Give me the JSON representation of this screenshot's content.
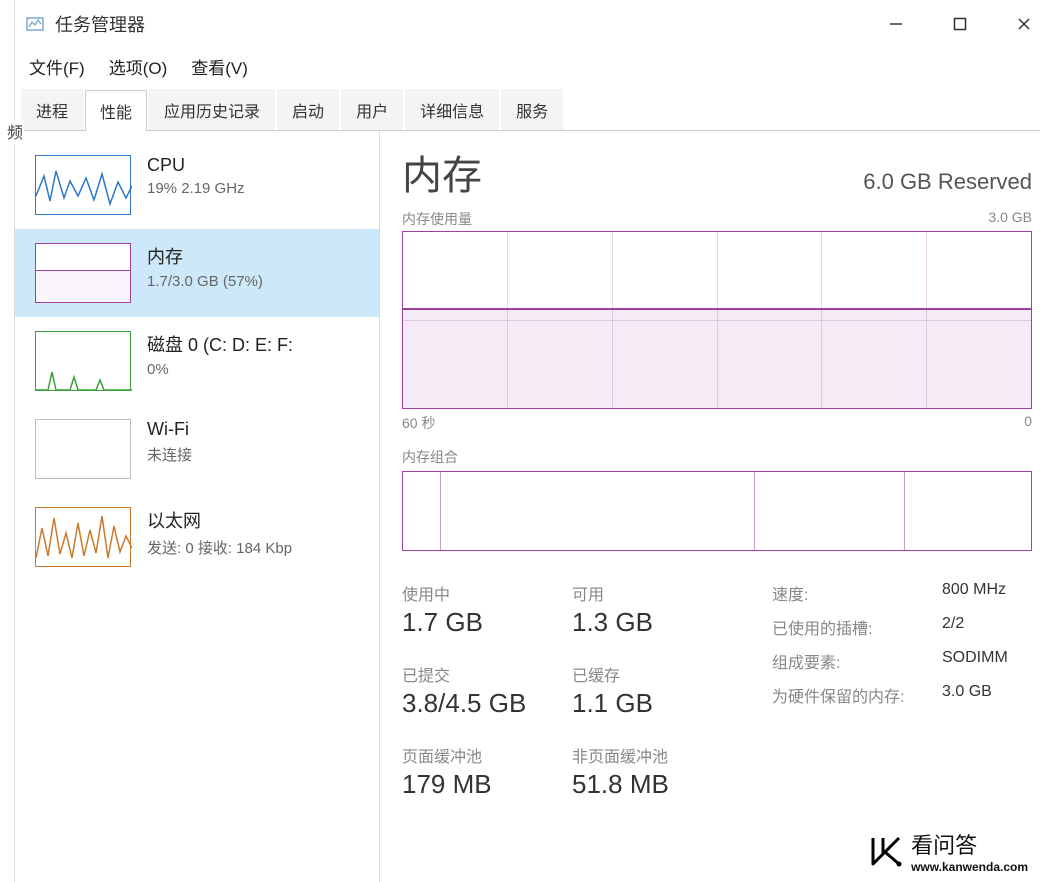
{
  "window": {
    "title": "任务管理器"
  },
  "menu": {
    "file": "文件(F)",
    "options": "选项(O)",
    "view": "查看(V)"
  },
  "tabs": {
    "processes": "进程",
    "performance": "性能",
    "app_history": "应用历史记录",
    "startup": "启动",
    "users": "用户",
    "details": "详细信息",
    "services": "服务"
  },
  "sidebar": {
    "cpu": {
      "name": "CPU",
      "detail": "19% 2.19 GHz"
    },
    "memory": {
      "name": "内存",
      "detail": "1.7/3.0 GB (57%)"
    },
    "disk": {
      "name": "磁盘 0 (C: D: E: F:",
      "detail": "0%"
    },
    "wifi": {
      "name": "Wi-Fi",
      "detail": "未连接"
    },
    "ethernet": {
      "name": "以太网",
      "detail": "发送: 0 接收: 184 Kbp"
    }
  },
  "main": {
    "title": "内存",
    "header_right": "6.0 GB Reserved",
    "chart_title": "内存使用量",
    "chart_max": "3.0 GB",
    "axis_left": "60 秒",
    "axis_right": "0",
    "composition_title": "内存组合"
  },
  "stats": {
    "in_use": {
      "label": "使用中",
      "value": "1.7 GB"
    },
    "available": {
      "label": "可用",
      "value": "1.3 GB"
    },
    "committed": {
      "label": "已提交",
      "value": "3.8/4.5 GB"
    },
    "cached": {
      "label": "已缓存",
      "value": "1.1 GB"
    },
    "paged": {
      "label": "页面缓冲池",
      "value": "179 MB"
    },
    "nonpaged": {
      "label": "非页面缓冲池",
      "value": "51.8 MB"
    }
  },
  "specs": {
    "speed": {
      "label": "速度:",
      "value": "800 MHz"
    },
    "slots": {
      "label": "已使用的插槽:",
      "value": "2/2"
    },
    "form": {
      "label": "组成要素:",
      "value": "SODIMM"
    },
    "reserved": {
      "label": "为硬件保留的内存:",
      "value": "3.0 GB"
    }
  },
  "watermark": {
    "text": "看问答",
    "url": "www.kanwenda.com"
  },
  "edge_tab": "频",
  "chart_data": {
    "type": "area",
    "title": "内存使用量",
    "ylabel": "GB",
    "ylim": [
      0,
      3.0
    ],
    "x_window_seconds": 60,
    "values": [
      1.7,
      1.7,
      1.7,
      1.7,
      1.7,
      1.7,
      1.7,
      1.7,
      1.7,
      1.7,
      1.7,
      1.7
    ],
    "fill_percent": 57
  }
}
